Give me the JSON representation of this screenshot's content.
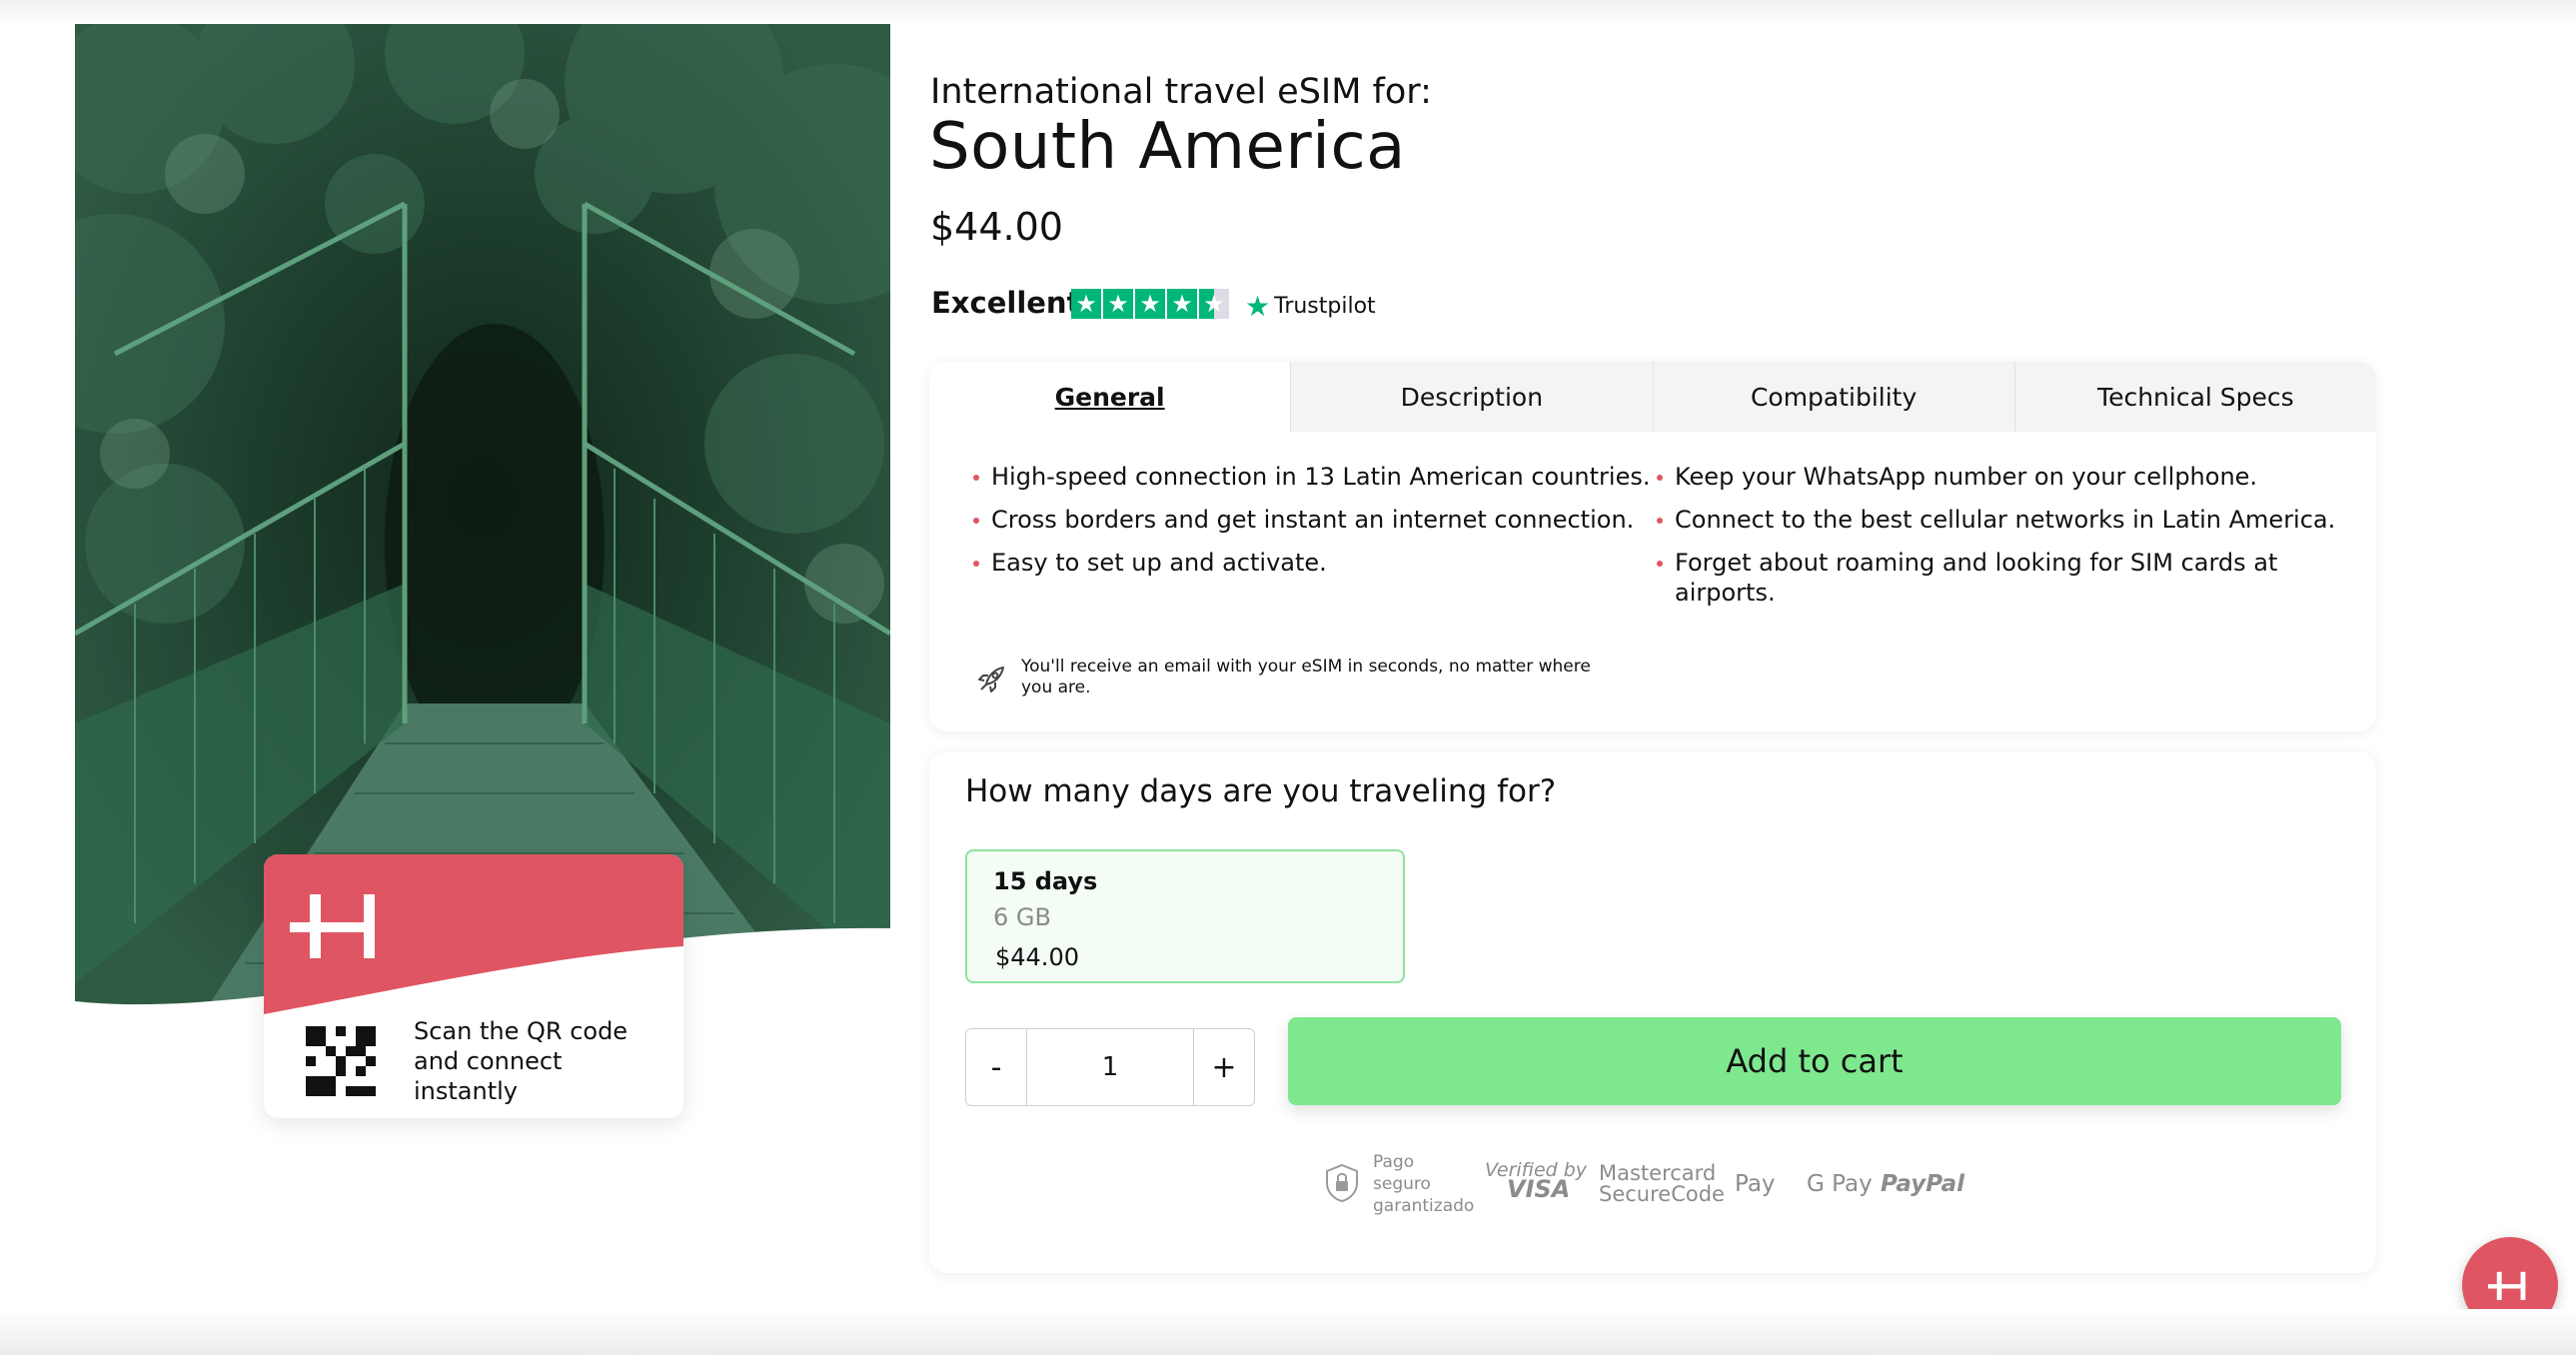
{
  "product": {
    "subtitle": "International travel eSIM for:",
    "title": "South America",
    "price": "$44.00"
  },
  "rating": {
    "label": "Excellent",
    "stars": 4.5,
    "provider": "Trustpilot",
    "star_color": "#00b67a"
  },
  "tabs": [
    {
      "label": "General",
      "active": true
    },
    {
      "label": "Description",
      "active": false
    },
    {
      "label": "Compatibility",
      "active": false
    },
    {
      "label": "Technical Specs",
      "active": false
    }
  ],
  "general": {
    "left_bullets": [
      "High-speed connection in 13 Latin American countries.",
      "Cross borders and get instant an internet connection.",
      "Easy to set up and activate."
    ],
    "right_bullets": [
      "Keep your WhatsApp number on your cellphone.",
      "Connect to the best cellular networks in Latin America.",
      "Forget about roaming and looking for SIM cards at airports."
    ],
    "note": "You'll receive an email with your eSIM in seconds, no matter where you are.",
    "note_icon": "rocket-icon"
  },
  "promo": {
    "text": "Scan the QR code and connect instantly",
    "brand_color": "#e05563"
  },
  "plans": {
    "question": "How many days are you traveling for?",
    "options": [
      {
        "days": "15 days",
        "data": "6 GB",
        "price": "$44.00",
        "selected": true
      }
    ]
  },
  "quantity": {
    "minus": "-",
    "value": "1",
    "plus": "+"
  },
  "cta": {
    "label": "Add to cart",
    "color": "#7ee88f"
  },
  "payments": {
    "secure": [
      "Pago",
      "seguro",
      "garantizado"
    ],
    "visa": [
      "Verified by",
      "VISA"
    ],
    "mastercard": [
      "Mastercard",
      "SecureCode"
    ],
    "apple_pay": "Pay",
    "google_pay": "G Pay",
    "paypal": "PayPal"
  }
}
